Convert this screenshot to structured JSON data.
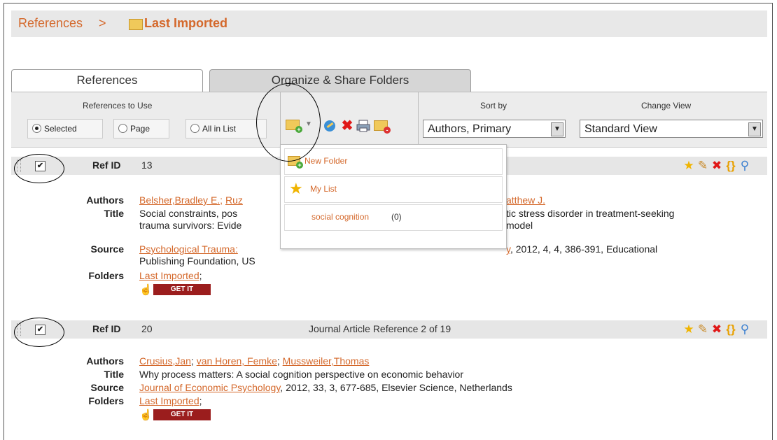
{
  "breadcrumb": {
    "root": "References",
    "separator": ">",
    "current": "Last Imported"
  },
  "tabs": {
    "references": "References",
    "organize": "Organize & Share Folders"
  },
  "toolbar": {
    "references_to_use": "References to Use",
    "radio_selected": "Selected",
    "radio_page": "Page",
    "radio_all": "All in List",
    "sort_by_label": "Sort by",
    "sort_by_value": "Authors, Primary",
    "change_view_label": "Change View",
    "change_view_value": "Standard View"
  },
  "dropdown": {
    "new_folder": "New Folder",
    "my_list": "My List",
    "folder_name": "social cognition",
    "folder_count": "(0)"
  },
  "records": [
    {
      "refid_label": "Ref ID",
      "refid": "13",
      "center_text": "",
      "authors_label": "Authors",
      "authors": [
        "Belsher,Bradley E.;",
        "Ruz",
        "atthew J."
      ],
      "title_label": "Title",
      "title_line1_left": "Social constraints, pos",
      "title_line1_right": "tic stress disorder in treatment-seeking",
      "title_line2_left": "trauma survivors: Evide",
      "title_line2_right": "model",
      "source_label": "Source",
      "source_link": "Psychological Trauma:",
      "source_tail_link": "y",
      "source_rest": ", 2012, 4, 4, 386-391, Educational",
      "source_line2": "Publishing Foundation, US",
      "folders_label": "Folders",
      "folder_link": "Last Imported",
      "folder_sep": ";",
      "getit": "GET IT"
    },
    {
      "refid_label": "Ref ID",
      "refid": "20",
      "center_text": "Journal Article Reference 2 of 19",
      "authors_label": "Authors",
      "authors": [
        "Crusius,Jan",
        "van Horen, Femke",
        "Mussweiler,Thomas"
      ],
      "title_label": "Title",
      "title": "Why process matters: A social cognition perspective on economic behavior",
      "source_label": "Source",
      "source_link": "Journal of Economic Psychology",
      "source_rest": ", 2012, 33, 3, 677-685, Elsevier Science, Netherlands",
      "folders_label": "Folders",
      "folder_link": "Last Imported",
      "folder_sep": ";",
      "getit": "GET IT"
    }
  ],
  "colors": {
    "link": "#d4682b",
    "getit": "#9b1d1d",
    "toolbar_bg": "#ececec"
  }
}
